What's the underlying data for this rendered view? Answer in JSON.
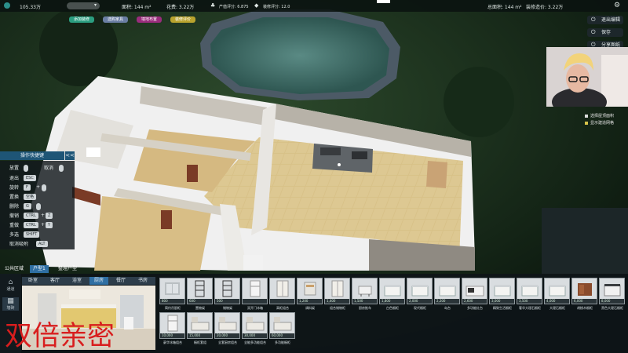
{
  "topbar": {
    "money": "105.33万",
    "area_label": "面积: 144 m²",
    "flower_label": "花费: 3.22万",
    "score1_label": "产值评分: 6.875",
    "score2_label": "装修评分: 12.0",
    "total_area_label": "总面积: 144 m²",
    "deco_cost_label": "装修造价: 3.22万",
    "gear_icon": "gear-icon"
  },
  "chips": [
    {
      "label": "添加装修",
      "color": "#2b9e80"
    },
    {
      "label": "选购家具",
      "color": "#6a7ea3"
    },
    {
      "label": "墙地布置",
      "color": "#9a2c7c"
    },
    {
      "label": "装修评价",
      "color": "#b9a32e"
    }
  ],
  "right_buttons": [
    {
      "label": "退出编辑"
    },
    {
      "label": "保存"
    },
    {
      "label": "分享图纸"
    }
  ],
  "camera_options": [
    {
      "label": "选择屋顶面积"
    },
    {
      "label": "显示建造网格"
    }
  ],
  "shortcuts": {
    "title": "操作快捷键",
    "collapse": "<<",
    "place": "放置",
    "cancel": "取消",
    "exit": "退出",
    "esc": "ESC",
    "rotate": "旋转",
    "f": "F",
    "plus": "+",
    "replace": "置换",
    "space": "空格",
    "delete": "删除",
    "g": "G",
    "undo": "撤销",
    "ctrl": "CTRL",
    "z": "Z",
    "redo": "重做",
    "y": "Y",
    "multiselect": "多选",
    "shift": "SHIFT",
    "cancel_snap": "取消吸附",
    "alt": "ALT"
  },
  "tabs": [
    {
      "label": "公共区域",
      "active": false
    },
    {
      "label": "户型1",
      "active": true
    },
    {
      "label": "整理户型",
      "active": false
    }
  ],
  "side_items": [
    {
      "label": "通道"
    },
    {
      "label": "墙砖"
    }
  ],
  "subtabs": [
    {
      "label": "卧室"
    },
    {
      "label": "客厅"
    },
    {
      "label": "浴室"
    },
    {
      "label": "厨房"
    },
    {
      "label": "餐厅"
    },
    {
      "label": "书房"
    }
  ],
  "active_subtab": 3,
  "watermark": "双倍亲密",
  "cards": [
    {
      "name": "简约吊厨柜",
      "price": "800",
      "kind": "cabinet"
    },
    {
      "name": "置物架",
      "price": "600",
      "kind": "shelf"
    },
    {
      "name": "储物架",
      "price": "500",
      "kind": "shelf"
    },
    {
      "name": "双开门冰箱",
      "price": "",
      "kind": "fridge"
    },
    {
      "name": "高柜组合",
      "price": "",
      "kind": "tall"
    },
    {
      "name": "调料架",
      "price": "1,200",
      "kind": "rack"
    },
    {
      "name": "组合储物柜",
      "price": "1,400",
      "kind": "tall"
    },
    {
      "name": "厨房推车",
      "price": "1,500",
      "kind": "cart"
    },
    {
      "name": "白色橱柜",
      "price": "1,800",
      "kind": "box"
    },
    {
      "name": "现代橱柜",
      "price": "2,000",
      "kind": "box"
    },
    {
      "name": "岛台",
      "price": "2,200",
      "kind": "box"
    },
    {
      "name": "多功能灶台",
      "price": "2,600",
      "kind": "stove"
    },
    {
      "name": "精致生活橱柜",
      "price": "3,000",
      "kind": "box"
    },
    {
      "name": "奢华大理石橱柜",
      "price": "3,500",
      "kind": "box"
    },
    {
      "name": "大理石橱柜",
      "price": "4,000",
      "kind": "box"
    },
    {
      "name": "胡桃木橱柜",
      "price": "6,000",
      "kind": "wood"
    },
    {
      "name": "黑色大理石橱柜",
      "price": "8,000",
      "kind": "dark"
    },
    {
      "name": "豪华冰箱组合",
      "price": "10,000",
      "kind": "fridge"
    },
    {
      "name": "橱柜套组",
      "price": "15,000",
      "kind": "set"
    },
    {
      "name": "全套厨房组合",
      "price": "20,000",
      "kind": "set"
    },
    {
      "name": "全能多功能组合",
      "price": "30,000",
      "kind": "set"
    },
    {
      "name": "多功能橱柜",
      "price": "60,000",
      "kind": "set"
    }
  ]
}
